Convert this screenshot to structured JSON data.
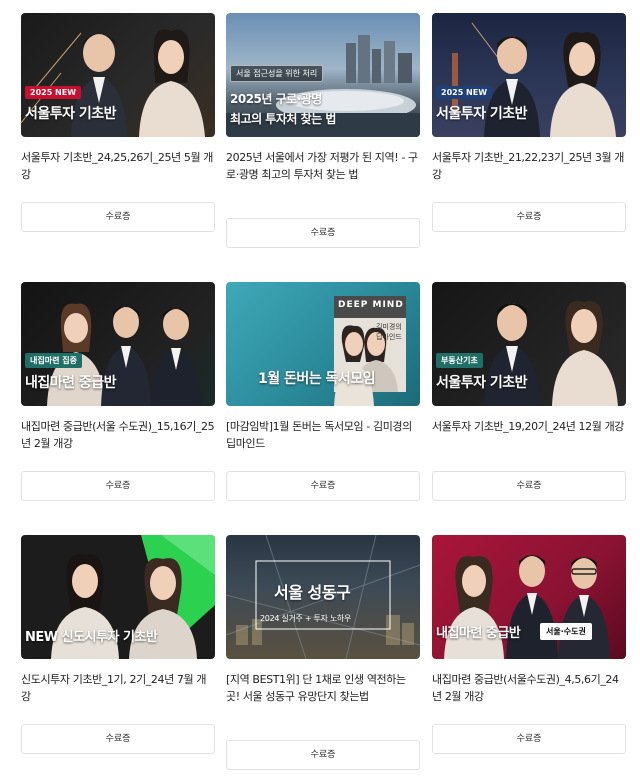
{
  "cards": [
    {
      "badge": "2025 NEW",
      "caption": "서울투자 기초반",
      "title": "서울투자 기초반_24,25,26기_25년 5월 개강",
      "button": "수료증"
    },
    {
      "tag": "서울 접근성을 위한 처리",
      "caption_line1": "2025년 구로·광명",
      "caption_line2": "최고의 투자처 찾는 법",
      "title": "2025년 서울에서 가장 저평가 된 지역! - 구로·광명 최고의 투자처 찾는 법",
      "button": "수료증"
    },
    {
      "badge": "2025 NEW",
      "caption": "서울투자 기초반",
      "title": "서울투자 기초반_21,22,23기_25년 3월 개강",
      "button": "수료증"
    },
    {
      "badge": "내집마련 집중",
      "caption": "내집마련 중급반",
      "title": "내집마련 중급반(서울 수도권)_15,16기_25년 2월 개강",
      "button": "수료증"
    },
    {
      "book_title": "DEEP MIND",
      "book_sub": "김미경의 딥마인드",
      "caption": "1월 돈버는 독서모임",
      "title": "[마감임박]1월 돈버는 독서모임 - 김미경의 딥마인드",
      "button": "수료증"
    },
    {
      "badge": "부동산기초",
      "caption": "서울투자 기초반",
      "title": "서울투자 기초반_19,20기_24년 12월 개강",
      "button": "수료증"
    },
    {
      "caption": "NEW 신도시투자 기초반",
      "title": "신도시투자 기초반_1기, 2기_24년 7월 개강",
      "button": "수료증"
    },
    {
      "caption": "서울 성동구",
      "sub": "2024 실거주 + 투자 노하우",
      "title": "[지역 BEST1위] 단 1채로 인생 역전하는 곳! 서울 성동구 유망단지 찾는법",
      "button": "수료증"
    },
    {
      "caption": "내집마련 중급반",
      "tag": "서울·수도권",
      "title": "내집마련 중급반(서울수도권)_4,5,6기_24년 2월 개강",
      "button": "수료증"
    }
  ],
  "colors": {
    "badge_red": "#c8102e",
    "badge_teal": "#1f6f66",
    "accent_green": "#2bd14f",
    "wine": "#8a1232"
  }
}
